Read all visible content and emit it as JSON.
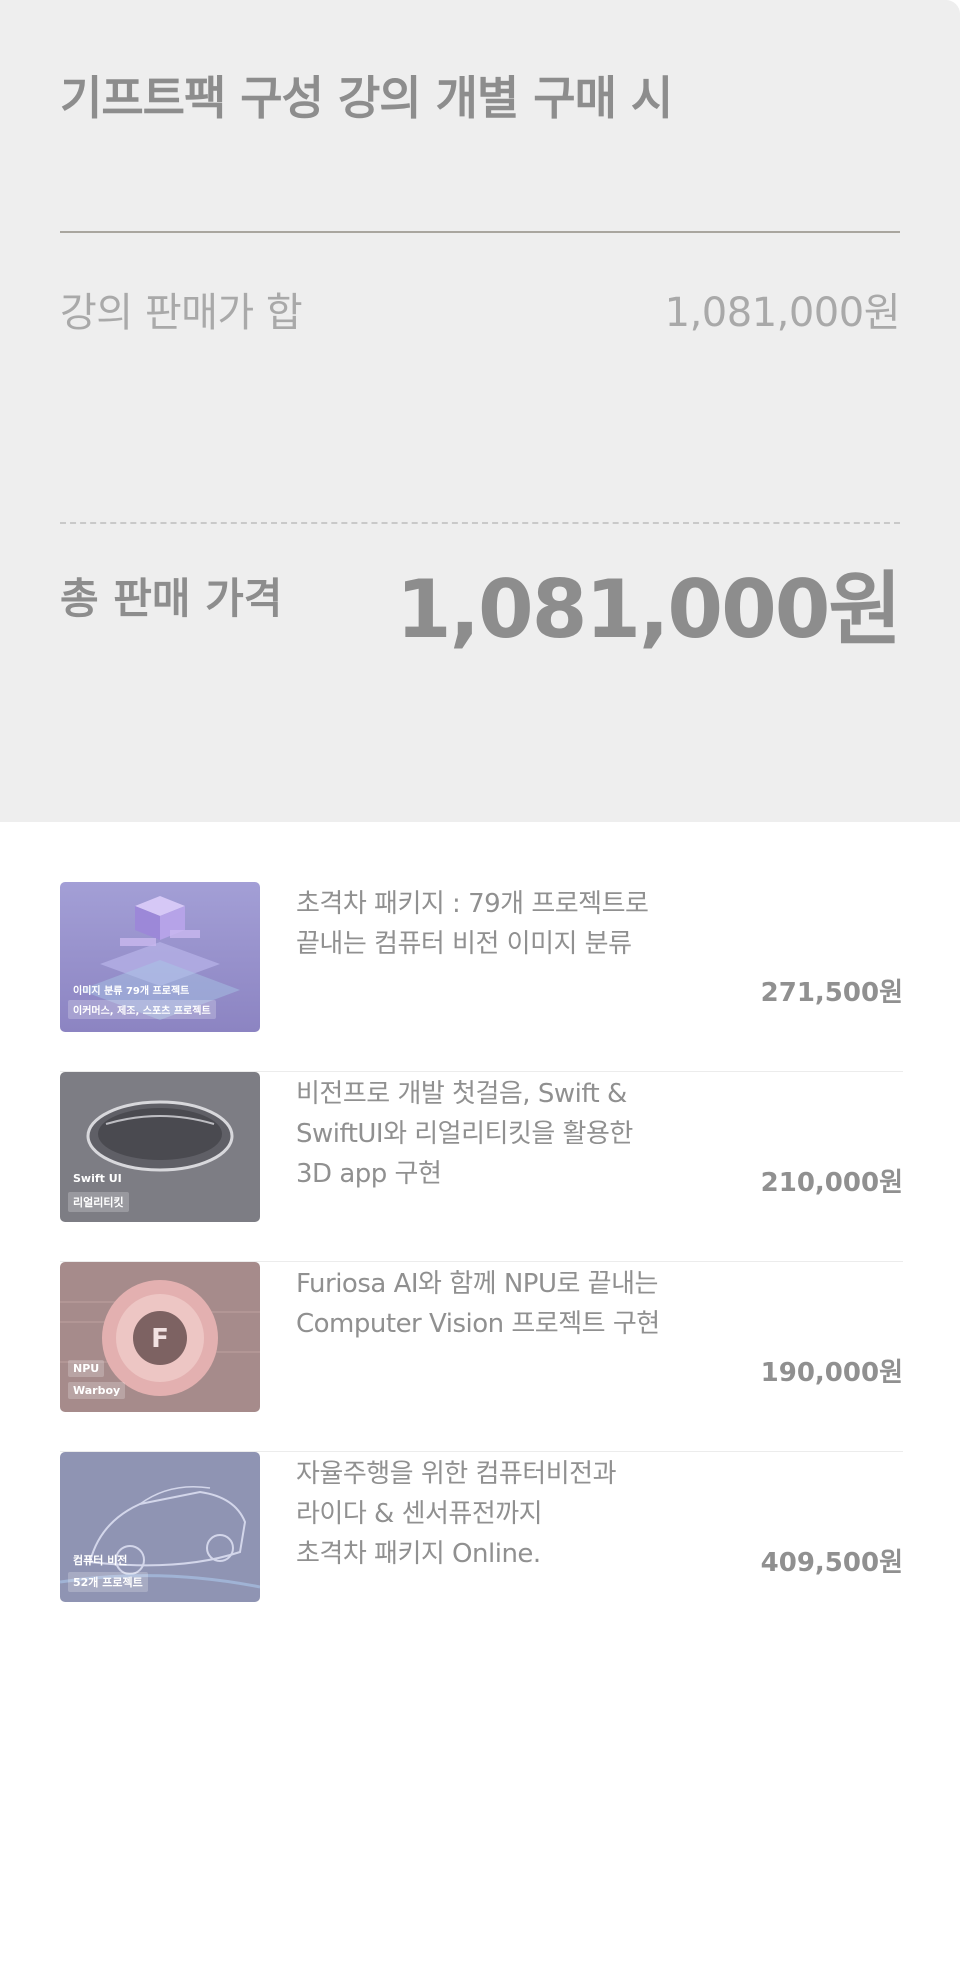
{
  "summary": {
    "title": "기프트팩 구성 강의 개별 구매 시",
    "subtotal_label": "강의 판매가 합",
    "subtotal_value": "1,081,000원",
    "total_label": "총 판매 가격",
    "total_value": "1,081,000원"
  },
  "courses": [
    {
      "title_lines": [
        "초격차 패키지 : 79개 프로젝트로",
        "끝내는 컴퓨터 비전 이미지 분류"
      ],
      "price": "271,500원",
      "thumb_tags": [
        "이미지 분류 79개 프로젝트",
        "이커머스, 제조, 스포츠 프로젝트"
      ]
    },
    {
      "title_lines": [
        "비전프로 개발 첫걸음, Swift &",
        "SwiftUI와 리얼리티킷을 활용한",
        "3D app 구현"
      ],
      "price": "210,000원",
      "thumb_tags": [
        "Swift UI",
        "리얼리티킷"
      ]
    },
    {
      "title_lines": [
        "Furiosa AI와 함께 NPU로 끝내는",
        "Computer Vision 프로젝트 구현"
      ],
      "price": "190,000원",
      "thumb_tags": [
        "NPU",
        "Warboy"
      ]
    },
    {
      "title_lines": [
        "자율주행을 위한 컴퓨터비전과",
        "라이다 & 센서퓨전까지",
        "초격차 패키지 Online."
      ],
      "price": "409,500원",
      "thumb_tags": [
        "컴퓨터 비전",
        "52개 프로젝트"
      ]
    }
  ],
  "colors": {
    "summary_bg": "#eeeeee",
    "text": "#8d8d8d",
    "thumb_1": "#9b93c8",
    "thumb_2": "#7f7f86",
    "thumb_3": "#a88a8a",
    "thumb_4": "#8f95b4"
  }
}
